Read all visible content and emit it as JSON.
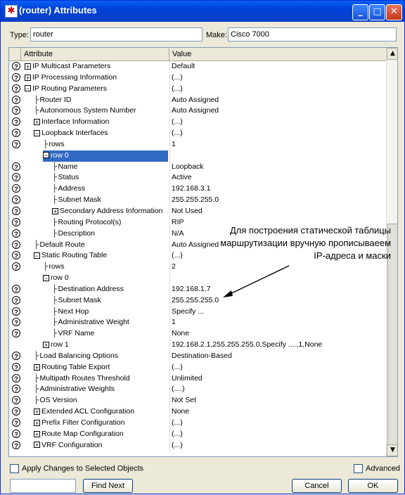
{
  "window": {
    "title": "(router) Attributes",
    "buttons": [
      "_",
      "□",
      "✕"
    ]
  },
  "type_label": "Type:",
  "type_value": "router",
  "make_label": "Make:",
  "make_value": "Cisco 7000",
  "columns": {
    "attribute": "Attribute",
    "value": "Value"
  },
  "rows": [
    {
      "indent": 0,
      "exp": "+",
      "attr": "IP Multicast Parameters",
      "value": "Default",
      "help": true
    },
    {
      "indent": 0,
      "exp": "+",
      "attr": "IP Processing Information",
      "value": "(...)",
      "help": true
    },
    {
      "indent": 0,
      "exp": "−",
      "attr": "IP Routing Parameters",
      "value": "(...)",
      "help": true
    },
    {
      "indent": 1,
      "exp": "",
      "attr": "Router ID",
      "value": "Auto Assigned",
      "help": true
    },
    {
      "indent": 1,
      "exp": "",
      "attr": "Autonomous System Number",
      "value": "Auto Assigned",
      "help": true
    },
    {
      "indent": 1,
      "exp": "+",
      "attr": "Interface Information",
      "value": "(...)",
      "help": true
    },
    {
      "indent": 1,
      "exp": "−",
      "attr": "Loopback Interfaces",
      "value": "(...)",
      "help": true
    },
    {
      "indent": 2,
      "exp": "",
      "attr": "rows",
      "value": "1",
      "help": true
    },
    {
      "indent": 2,
      "exp": "−",
      "attr": "row 0",
      "value": "",
      "help": false,
      "selected": true
    },
    {
      "indent": 3,
      "exp": "",
      "attr": "Name",
      "value": "Loopback",
      "help": true
    },
    {
      "indent": 3,
      "exp": "",
      "attr": "Status",
      "value": "Active",
      "help": true
    },
    {
      "indent": 3,
      "exp": "",
      "attr": "Address",
      "value": "192.168.3.1",
      "help": true
    },
    {
      "indent": 3,
      "exp": "",
      "attr": "Subnet Mask",
      "value": "255.255.255.0",
      "help": true
    },
    {
      "indent": 3,
      "exp": "+",
      "attr": "Secondary Address Information",
      "value": "Not Used",
      "help": true
    },
    {
      "indent": 3,
      "exp": "",
      "attr": "Routing Protocol(s)",
      "value": "RIP",
      "help": true
    },
    {
      "indent": 3,
      "exp": "",
      "attr": "Description",
      "value": "N/A",
      "help": true
    },
    {
      "indent": 1,
      "exp": "",
      "attr": "Default Route",
      "value": "Auto Assigned",
      "help": true
    },
    {
      "indent": 1,
      "exp": "−",
      "attr": "Static Routing Table",
      "value": "(...)",
      "help": true
    },
    {
      "indent": 2,
      "exp": "",
      "attr": "rows",
      "value": "2",
      "help": true
    },
    {
      "indent": 2,
      "exp": "−",
      "attr": "row 0",
      "value": "",
      "help": false
    },
    {
      "indent": 3,
      "exp": "",
      "attr": "Destination Address",
      "value": "192.168.1.7",
      "help": true
    },
    {
      "indent": 3,
      "exp": "",
      "attr": "Subnet Mask",
      "value": "255.255.255.0",
      "help": true
    },
    {
      "indent": 3,
      "exp": "",
      "attr": "Next Hop",
      "value": "Specify ...",
      "help": true
    },
    {
      "indent": 3,
      "exp": "",
      "attr": "Administrative Weight",
      "value": "1",
      "help": true
    },
    {
      "indent": 3,
      "exp": "",
      "attr": "VRF Name",
      "value": "None",
      "help": true
    },
    {
      "indent": 2,
      "exp": "+",
      "attr": "row 1",
      "value": "192.168.2.1,255.255.255.0,Specify ....,1,None",
      "help": false
    },
    {
      "indent": 1,
      "exp": "",
      "attr": "Load Balancing Options",
      "value": "Destination-Based",
      "help": true
    },
    {
      "indent": 1,
      "exp": "+",
      "attr": "Routing Table Export",
      "value": "(...)",
      "help": true
    },
    {
      "indent": 1,
      "exp": "",
      "attr": "Multipath Routes Threshold",
      "value": "Unlimited",
      "help": true
    },
    {
      "indent": 1,
      "exp": "",
      "attr": "Administrative Weights",
      "value": "(....)",
      "help": true
    },
    {
      "indent": 1,
      "exp": "",
      "attr": "OS Version",
      "value": "Not Set",
      "help": true
    },
    {
      "indent": 1,
      "exp": "+",
      "attr": "Extended ACL Configuration",
      "value": "None",
      "help": true
    },
    {
      "indent": 1,
      "exp": "+",
      "attr": "Prefix Filter Configuration",
      "value": "(...)",
      "help": true
    },
    {
      "indent": 1,
      "exp": "+",
      "attr": "Route Map Configuration",
      "value": "(...)",
      "help": true
    },
    {
      "indent": 1,
      "exp": "+",
      "attr": "VRF Configuration",
      "value": "(...)",
      "help": true
    }
  ],
  "annotation": "Для построения статической таблицы маршрутизации вручную прописываеем IP-адреса и маски",
  "apply_label": "Apply Changes to Selected Objects",
  "advanced_label": "Advanced",
  "find_next_label": "Find Next",
  "cancel_label": "Cancel",
  "ok_label": "OK",
  "help_icon_glyph": "?"
}
